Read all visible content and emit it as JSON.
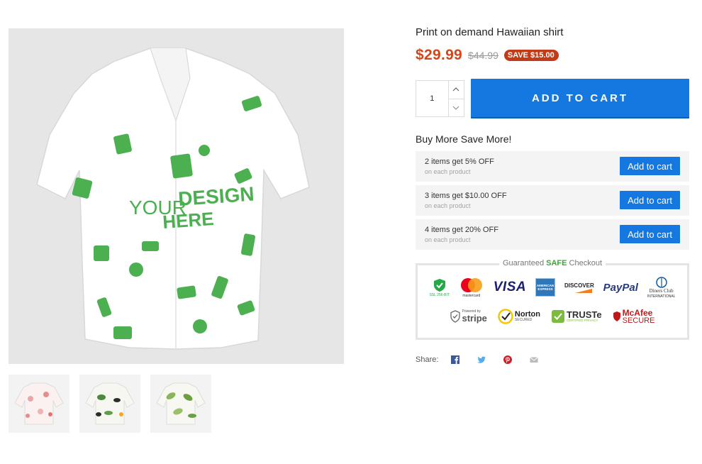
{
  "gallery": {
    "main_image_icon": "shirt-image",
    "main_print_text_1": "YOUR",
    "main_print_text_2": "DESIGN",
    "main_print_text_3": "HERE",
    "print_color": "#4caf50",
    "thumbnails": [
      {
        "icon": "flamingo-shirt-thumbnail"
      },
      {
        "icon": "toucan-shirt-thumbnail"
      },
      {
        "icon": "leaf-shirt-thumbnail"
      }
    ]
  },
  "product": {
    "title": "Print on demand Hawaiian shirt",
    "price": "$29.99",
    "compare_price": "$44.99",
    "save_badge": "SAVE $15.00",
    "quantity": "1",
    "add_to_cart_label": "ADD TO CART",
    "accent_color": "#1478e0",
    "price_color": "#d2461b"
  },
  "bundle": {
    "title": "Buy More Save More!",
    "tiers": [
      {
        "name": "2 items get 5% OFF",
        "sub": "on each product",
        "button": "Add to cart"
      },
      {
        "name": "3 items get $10.00 OFF",
        "sub": "on each product",
        "button": "Add to cart"
      },
      {
        "name": "4 items get 20% OFF",
        "sub": "on each product",
        "button": "Add to cart"
      }
    ]
  },
  "checkout": {
    "legend_pre": "Guaranteed",
    "legend_hl": "SAFE",
    "legend_post": "Checkout",
    "badges": {
      "ssl": "SSL 256-BIT",
      "mastercard": "mastercard",
      "visa": "VISA",
      "amex_1": "AMERICAN",
      "amex_2": "EXPRESS",
      "discover": "DISCOVER",
      "paypal": "PayPal",
      "diners_1": "Diners Club",
      "diners_2": "INTERNATIONAL",
      "stripe_1": "Powered by",
      "stripe_2": "stripe",
      "norton_1": "Norton",
      "norton_2": "SECURED",
      "truste_1": "TRUSTe",
      "truste_2": "CERTIFIED PRIVACY",
      "mcafee_1": "McAfee",
      "mcafee_2": "SECURE"
    }
  },
  "share": {
    "label": "Share:",
    "icons": [
      "facebook-icon",
      "twitter-icon",
      "pinterest-icon",
      "email-icon"
    ]
  }
}
